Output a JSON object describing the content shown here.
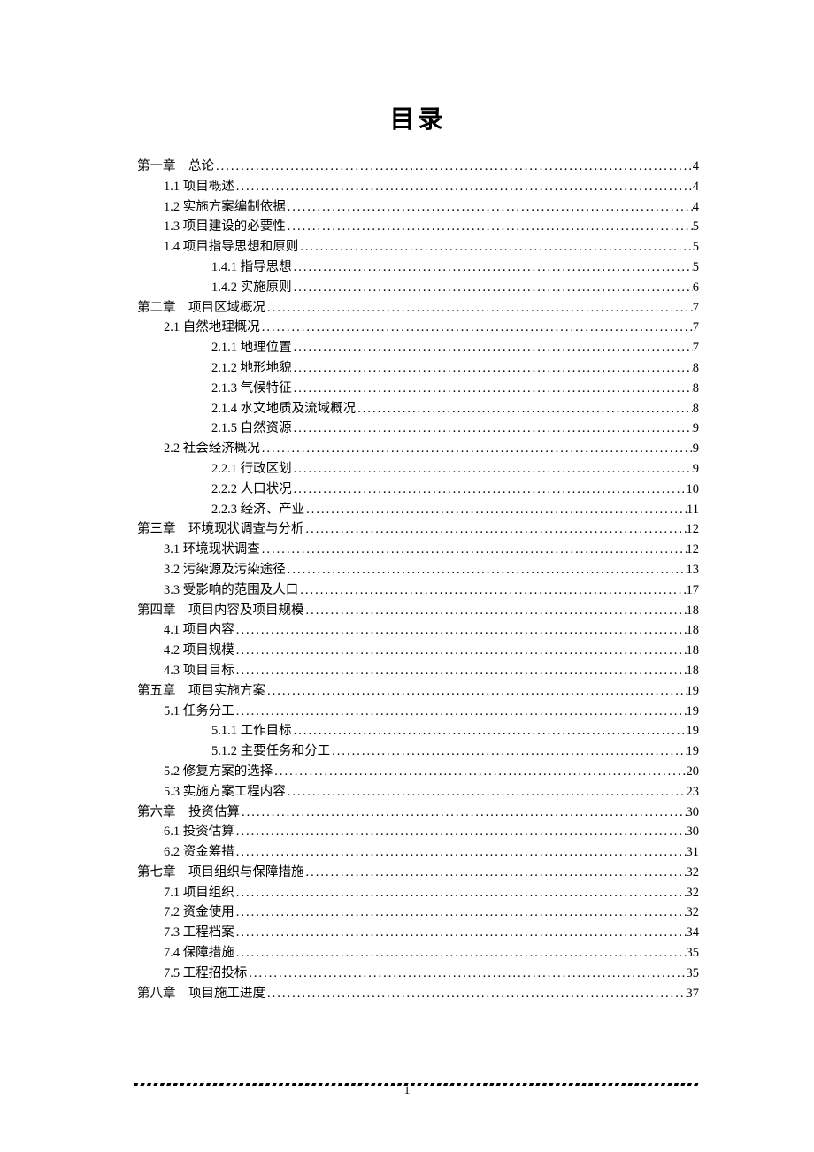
{
  "title": "目录",
  "pageNumber": "1",
  "entries": [
    {
      "level": 0,
      "label": "第一章　总论",
      "page": "4"
    },
    {
      "level": 1,
      "label": "1.1 项目概述",
      "page": "4"
    },
    {
      "level": 1,
      "label": "1.2 实施方案编制依据",
      "page": "4"
    },
    {
      "level": 1,
      "label": "1.3 项目建设的必要性",
      "page": "5"
    },
    {
      "level": 1,
      "label": "1.4 项目指导思想和原则",
      "page": "5"
    },
    {
      "level": 2,
      "label": "1.4.1 指导思想",
      "page": "5"
    },
    {
      "level": 2,
      "label": "1.4.2 实施原则",
      "page": "6"
    },
    {
      "level": 0,
      "label": "第二章　项目区域概况",
      "page": "7"
    },
    {
      "level": 1,
      "label": "2.1 自然地理概况",
      "page": "7"
    },
    {
      "level": 2,
      "label": "2.1.1 地理位置",
      "page": "7"
    },
    {
      "level": 2,
      "label": "2.1.2 地形地貌",
      "page": "8"
    },
    {
      "level": 2,
      "label": "2.1.3 气候特征",
      "page": "8"
    },
    {
      "level": 2,
      "label": "2.1.4 水文地质及流域概况",
      "page": "8"
    },
    {
      "level": 2,
      "label": "2.1.5 自然资源",
      "page": "9"
    },
    {
      "level": 1,
      "label": "2.2 社会经济概况",
      "page": "9"
    },
    {
      "level": 2,
      "label": "2.2.1 行政区划",
      "page": "9"
    },
    {
      "level": 2,
      "label": "2.2.2 人口状况",
      "page": "10"
    },
    {
      "level": 2,
      "label": "2.2.3 经济、产业",
      "page": "11"
    },
    {
      "level": 0,
      "label": "第三章　环境现状调查与分析",
      "page": "12"
    },
    {
      "level": 1,
      "label": "3.1 环境现状调查",
      "page": "12"
    },
    {
      "level": 1,
      "label": "3.2 污染源及污染途径",
      "page": "13"
    },
    {
      "level": 1,
      "label": "3.3 受影响的范围及人口",
      "page": "17"
    },
    {
      "level": 0,
      "label": "第四章　项目内容及项目规模",
      "page": "18"
    },
    {
      "level": 1,
      "label": "4.1 项目内容",
      "page": "18"
    },
    {
      "level": 1,
      "label": "4.2 项目规模",
      "page": "18"
    },
    {
      "level": 1,
      "label": "4.3 项目目标",
      "page": "18"
    },
    {
      "level": 0,
      "label": "第五章　项目实施方案",
      "page": "19"
    },
    {
      "level": 1,
      "label": "5.1 任务分工",
      "page": "19"
    },
    {
      "level": 2,
      "label": "5.1.1 工作目标",
      "page": "19"
    },
    {
      "level": 2,
      "label": "5.1.2 主要任务和分工",
      "page": "19"
    },
    {
      "level": 1,
      "label": "5.2 修复方案的选择",
      "page": "20"
    },
    {
      "level": 1,
      "label": "5.3 实施方案工程内容",
      "page": "23"
    },
    {
      "level": 0,
      "label": "第六章　投资估算",
      "page": "30"
    },
    {
      "level": 1,
      "label": "6.1 投资估算",
      "page": "30"
    },
    {
      "level": 1,
      "label": "6.2 资金筹措",
      "page": "31"
    },
    {
      "level": 0,
      "label": "第七章　项目组织与保障措施",
      "page": "32"
    },
    {
      "level": 1,
      "label": "7.1 项目组织",
      "page": "32"
    },
    {
      "level": 1,
      "label": "7.2 资金使用",
      "page": "32"
    },
    {
      "level": 1,
      "label": "7.3 工程档案",
      "page": "34"
    },
    {
      "level": 1,
      "label": "7.4 保障措施",
      "page": "35"
    },
    {
      "level": 1,
      "label": "7.5 工程招投标",
      "page": "35"
    },
    {
      "level": 0,
      "label": "第八章　项目施工进度",
      "page": "37"
    }
  ]
}
